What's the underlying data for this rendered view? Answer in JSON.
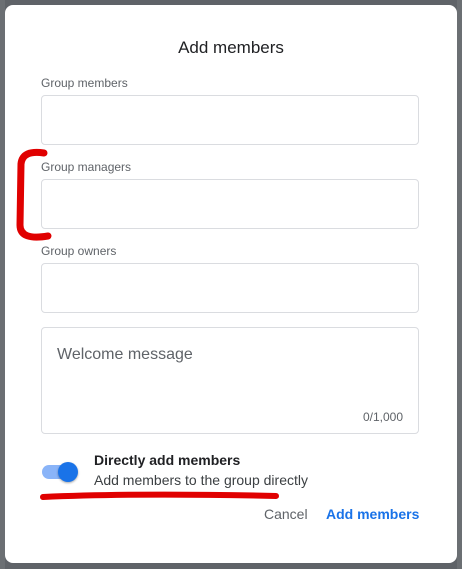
{
  "dialog": {
    "title": "Add members",
    "fields": [
      {
        "label": "Group members",
        "value": ""
      },
      {
        "label": "Group managers",
        "value": ""
      },
      {
        "label": "Group owners",
        "value": ""
      }
    ],
    "welcome": {
      "placeholder": "Welcome message",
      "counter": "0/1,000"
    },
    "toggle": {
      "title": "Directly add members",
      "description": "Add members to the group directly",
      "on": true
    },
    "buttons": {
      "cancel": "Cancel",
      "add": "Add members"
    }
  },
  "colors": {
    "accent": "#1a73e8",
    "annotation": "#e00000"
  }
}
